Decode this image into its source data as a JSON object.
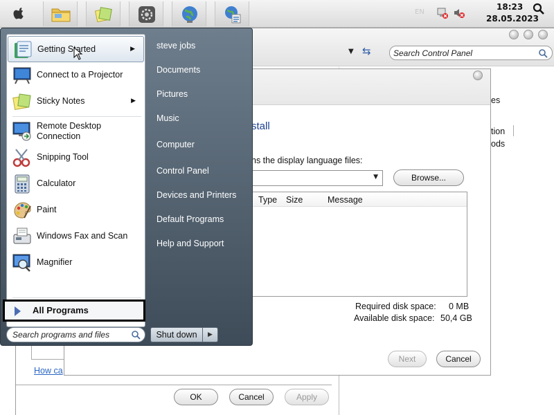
{
  "menubar": {
    "icons": [
      "apple-icon",
      "folder-icon",
      "sticky-notes-icon",
      "settings-icon",
      "globe-icon",
      "network-icon"
    ],
    "language": "EN",
    "time": "18:23",
    "date": "28.05.2023"
  },
  "control_panel": {
    "search_placeholder": "Search Control Panel",
    "partial_items": [
      "es",
      "tion",
      "ods"
    ],
    "bottom_link": "How ca",
    "ok": "OK",
    "cancel": "Cancel",
    "apply": "Apply"
  },
  "install_dialog": {
    "heading_partial": "stall",
    "prompt_partial": "ns the display language files:",
    "browse": "Browse...",
    "columns": [
      "Type",
      "Size",
      "Message"
    ],
    "required_label": "Required disk space:",
    "required_value": "0 MB",
    "available_label": "Available disk space:",
    "available_value": "50,4 GB",
    "next": "Next",
    "cancel": "Cancel"
  },
  "start_menu": {
    "programs": [
      {
        "label": "Getting Started",
        "icon": "getting-started-icon",
        "arrow": true
      },
      {
        "label": "Connect to a Projector",
        "icon": "projector-icon",
        "arrow": false
      },
      {
        "label": "Sticky Notes",
        "icon": "sticky-notes-icon",
        "arrow": true
      },
      {
        "label": "Remote Desktop Connection",
        "icon": "remote-desktop-icon",
        "arrow": false
      },
      {
        "label": "Snipping Tool",
        "icon": "scissors-icon",
        "arrow": false
      },
      {
        "label": "Calculator",
        "icon": "calculator-icon",
        "arrow": false
      },
      {
        "label": "Paint",
        "icon": "paint-icon",
        "arrow": false
      },
      {
        "label": "Windows Fax and Scan",
        "icon": "fax-icon",
        "arrow": false
      },
      {
        "label": "Magnifier",
        "icon": "magnifier-icon",
        "arrow": false
      }
    ],
    "remote_desktop_line1": "Remote Desktop",
    "remote_desktop_line2": "Connection",
    "all_programs": "All Programs",
    "search_placeholder": "Search programs and files",
    "right_items": [
      "steve jobs",
      "Documents",
      "Pictures",
      "Music",
      "Computer",
      "Control Panel",
      "Devices and Printers",
      "Default Programs",
      "Help and Support"
    ],
    "shutdown": "Shut down"
  }
}
